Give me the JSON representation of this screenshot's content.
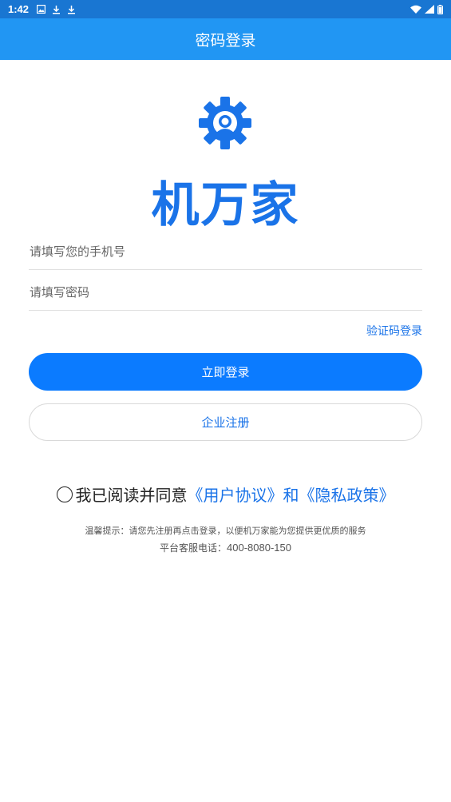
{
  "status_bar": {
    "time": "1:42",
    "left_icons": [
      "image-notification-icon",
      "download-icon",
      "download-icon"
    ],
    "right_icons": [
      "wifi-icon",
      "signal-icon",
      "battery-icon"
    ]
  },
  "app_bar": {
    "title": "密码登录"
  },
  "logo": {
    "icon": "gear-person-icon",
    "text": "机万家",
    "color": "#1a73e8"
  },
  "form": {
    "phone_placeholder": "请填写您的手机号",
    "phone_value": "",
    "password_placeholder": "请填写密码",
    "password_value": ""
  },
  "code_login_label": "验证码登录",
  "login_button_label": "立即登录",
  "register_button_label": "企业注册",
  "agreement": {
    "checked": false,
    "prefix": "我已阅读并同意",
    "user_agreement": "《用户协议》",
    "and": "和",
    "privacy_policy": "《隐私政策》"
  },
  "tips": {
    "line1": "温馨提示：请您先注册再点击登录，以便机万家能为您提供更优质的服务",
    "line2_label": "平台客服电话：",
    "line2_phone": "400-8080-150"
  },
  "colors": {
    "primary": "#0b7bff",
    "app_bar": "#2196f3",
    "status_bar": "#1976d2"
  }
}
